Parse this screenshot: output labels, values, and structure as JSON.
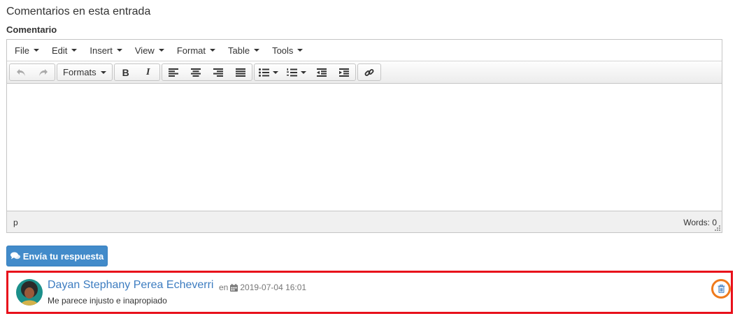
{
  "section": {
    "title": "Comentarios en esta entrada",
    "field_label": "Comentario"
  },
  "editor": {
    "menu": [
      "File",
      "Edit",
      "Insert",
      "View",
      "Format",
      "Table",
      "Tools"
    ],
    "toolbar": {
      "formats_label": "Formats",
      "bold": "B",
      "italic": "I"
    },
    "status": {
      "path": "p",
      "words": "Words: 0"
    }
  },
  "submit": {
    "label": "Envía tu respuesta"
  },
  "comment": {
    "author": "Dayan Stephany Perea Echeverri",
    "preposition": "en",
    "datetime": "2019-07-04 16:01",
    "text": "Me parece injusto e inapropiado"
  },
  "colors": {
    "primary": "#428bca",
    "link": "#3c7cc0",
    "highlight_border": "#e8101b",
    "delete_ring": "#ef7a1c"
  },
  "icons": [
    "undo-icon",
    "redo-icon",
    "align-left-icon",
    "align-center-icon",
    "align-right-icon",
    "justify-icon",
    "bullet-list-icon",
    "numbered-list-icon",
    "outdent-icon",
    "indent-icon",
    "link-icon",
    "comments-icon",
    "calendar-icon",
    "trash-icon"
  ]
}
